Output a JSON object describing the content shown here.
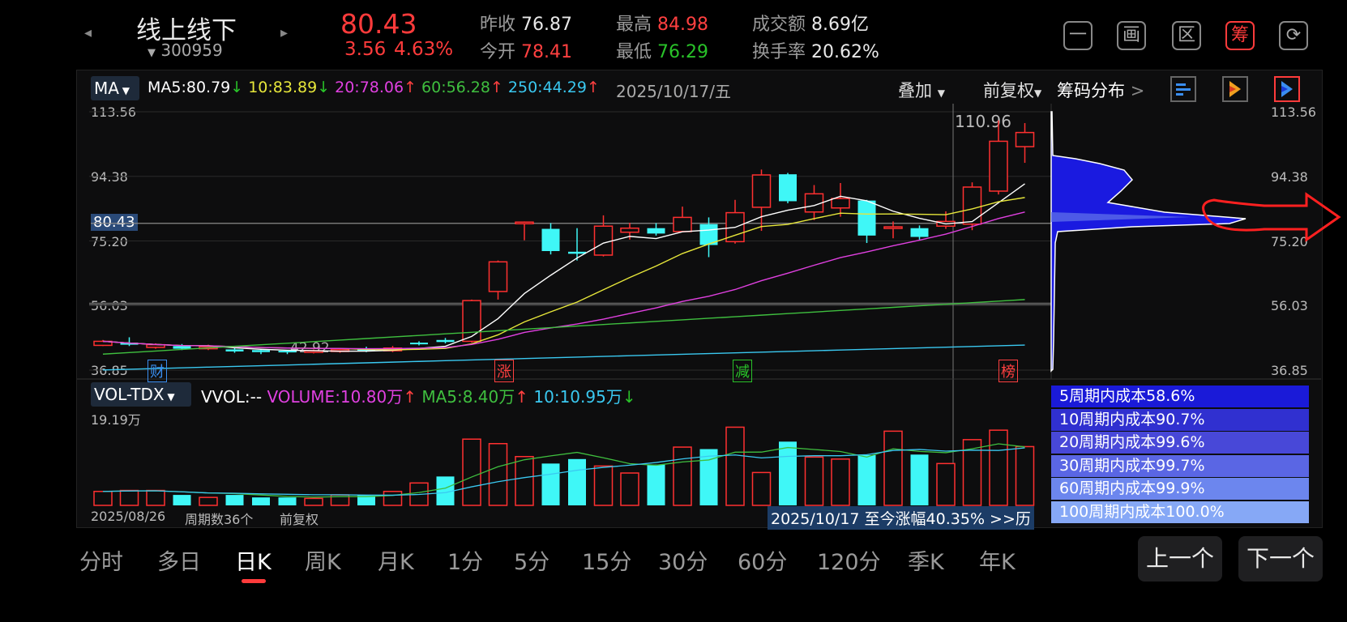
{
  "header": {
    "prev_arrow": "◂",
    "next_arrow": "▸",
    "stock_name": "线上线下",
    "stock_code": "300959",
    "price": "80.43",
    "change": "3.56",
    "change_pct": "4.63%",
    "stats": [
      {
        "label": "昨收",
        "value": "76.87",
        "color": "#e8e8e8"
      },
      {
        "label": "今开",
        "value": "78.41",
        "color": "#ff4040"
      },
      {
        "label": "最高",
        "value": "84.98",
        "color": "#ff4040"
      },
      {
        "label": "最低",
        "value": "76.29",
        "color": "#29c229"
      },
      {
        "label": "成交额",
        "value": "8.69亿",
        "color": "#e8e8e8"
      },
      {
        "label": "换手率",
        "value": "20.62%",
        "color": "#e8e8e8"
      }
    ],
    "buttons": [
      {
        "name": "minus",
        "glyph": "一"
      },
      {
        "name": "draw",
        "glyph": "画"
      },
      {
        "name": "region",
        "glyph": "区"
      },
      {
        "name": "chips",
        "glyph": "筹"
      },
      {
        "name": "rotate",
        "glyph": "⟳"
      }
    ]
  },
  "chart_toolbar": {
    "indicator": "MA",
    "ma_values": [
      {
        "text": "MA5:80.79",
        "arrow": "↓",
        "color": "#ffffff",
        "arrow_color": "#29c229"
      },
      {
        "text": "10:83.89",
        "arrow": "↓",
        "color": "#e6e63a",
        "arrow_color": "#29c229"
      },
      {
        "text": "20:78.06",
        "arrow": "↑",
        "color": "#e040e0",
        "arrow_color": "#ff4040"
      },
      {
        "text": "60:56.28",
        "arrow": "↑",
        "color": "#3fbf3f",
        "arrow_color": "#ff4040"
      },
      {
        "text": "250:44.29",
        "arrow": "↑",
        "color": "#3ac8f0",
        "arrow_color": "#ff4040"
      }
    ],
    "date": "2025/10/17/五",
    "overlay_label": "叠加",
    "adjust_label": "前复权",
    "chip_dist_label": "筹码分布",
    "chip_arrow": ">"
  },
  "price_axis": {
    "labels": [
      "113.56",
      "94.38",
      "75.20",
      "56.03",
      "36.85"
    ],
    "current_price_tag": "80.43",
    "peak_label": "110.96",
    "low_label": "42.92"
  },
  "markers": [
    {
      "text": "财",
      "color": "#3a8ef0"
    },
    {
      "text": "涨",
      "color": "#ff4040"
    },
    {
      "text": "减",
      "color": "#29c229"
    },
    {
      "text": "榜",
      "color": "#ff4040"
    }
  ],
  "volume_toolbar": {
    "indicator": "VOL-TDX",
    "vvol": "VVOL:--",
    "volume": "VOLUME:10.80万",
    "volume_arrow": "↑",
    "ma5": "MA5:8.40万",
    "ma5_arrow": "↑",
    "ma10": "10:10.95万",
    "ma10_arrow": "↓",
    "max_label": "19.19万"
  },
  "volume_footer": {
    "start_date": "2025/08/26",
    "period_count": "周期数36个",
    "adjust": "前复权",
    "range_info": "2025/10/17 至今涨幅40.35%",
    "range_more": ">>历"
  },
  "chip_costs": [
    {
      "text": "5周期内成本58.6%",
      "color": "#1a1ad8"
    },
    {
      "text": "10周期内成本90.7%",
      "color": "#3030d0"
    },
    {
      "text": "20周期内成本99.6%",
      "color": "#4848d8"
    },
    {
      "text": "30周期内成本99.7%",
      "color": "#5a66e4"
    },
    {
      "text": "60周期内成本99.9%",
      "color": "#6c86ee"
    },
    {
      "text": "100周期内成本100.0%",
      "color": "#86a8f6"
    }
  ],
  "period_tabs": [
    "分时",
    "多日",
    "日K",
    "周K",
    "月K",
    "1分",
    "5分",
    "15分",
    "30分",
    "60分",
    "120分",
    "季K",
    "年K"
  ],
  "active_tab": "日K",
  "nav": {
    "prev": "上一个",
    "next": "下一个"
  },
  "colors": {
    "up": "#ff3030",
    "down": "#3ff7f7",
    "accent": "#ff3b3b",
    "ma5": "#ffffff",
    "ma10": "#e6e63a",
    "ma20": "#e040e0",
    "ma60": "#3fbf3f",
    "ma250": "#3ac8f0"
  },
  "chart_data": {
    "type": "candlestick",
    "y_range": [
      36.85,
      113.56
    ],
    "candles": [
      {
        "o": 44.2,
        "c": 45.4,
        "h": 45.8,
        "l": 44.0,
        "up": true
      },
      {
        "o": 45.0,
        "c": 44.4,
        "h": 46.6,
        "l": 44.0,
        "up": false
      },
      {
        "o": 44.4,
        "c": 43.6,
        "h": 44.8,
        "l": 43.2,
        "up": true
      },
      {
        "o": 44.0,
        "c": 43.2,
        "h": 44.6,
        "l": 42.8,
        "up": false
      },
      {
        "o": 43.2,
        "c": 43.8,
        "h": 44.4,
        "l": 42.8,
        "up": true
      },
      {
        "o": 43.0,
        "c": 42.4,
        "h": 43.4,
        "l": 42.0,
        "up": false
      },
      {
        "o": 42.8,
        "c": 42.2,
        "h": 43.0,
        "l": 41.6,
        "up": false
      },
      {
        "o": 42.6,
        "c": 42.2,
        "h": 42.8,
        "l": 41.6,
        "up": false
      },
      {
        "o": 42.2,
        "c": 42.6,
        "h": 43.0,
        "l": 41.8,
        "up": true
      },
      {
        "o": 42.4,
        "c": 42.9,
        "h": 43.2,
        "l": 42.0,
        "up": true
      },
      {
        "o": 43.2,
        "c": 42.6,
        "h": 43.8,
        "l": 42.2,
        "up": false
      },
      {
        "o": 42.6,
        "c": 43.4,
        "h": 44.0,
        "l": 42.2,
        "up": true
      },
      {
        "o": 44.6,
        "c": 45.0,
        "h": 45.4,
        "l": 44.2,
        "up": false
      },
      {
        "o": 45.2,
        "c": 45.8,
        "h": 46.4,
        "l": 44.8,
        "up": false
      },
      {
        "o": 45.4,
        "c": 57.5,
        "h": 57.8,
        "l": 45.0,
        "up": true
      },
      {
        "o": 60.2,
        "c": 69.0,
        "h": 69.4,
        "l": 57.8,
        "up": true
      },
      {
        "o": 80.8,
        "c": 80.6,
        "h": 81.0,
        "l": 75.4,
        "up": true
      },
      {
        "o": 78.8,
        "c": 72.2,
        "h": 80.5,
        "l": 71.2,
        "up": false
      },
      {
        "o": 72.0,
        "c": 71.4,
        "h": 79.0,
        "l": 69.4,
        "up": false
      },
      {
        "o": 71.0,
        "c": 79.6,
        "h": 82.8,
        "l": 70.6,
        "up": true
      },
      {
        "o": 77.8,
        "c": 79.0,
        "h": 80.6,
        "l": 75.6,
        "up": true
      },
      {
        "o": 79.0,
        "c": 77.4,
        "h": 80.5,
        "l": 76.8,
        "up": false
      },
      {
        "o": 78.0,
        "c": 82.2,
        "h": 85.4,
        "l": 77.8,
        "up": true
      },
      {
        "o": 80.2,
        "c": 74.0,
        "h": 82.2,
        "l": 70.4,
        "up": false
      },
      {
        "o": 75.0,
        "c": 83.6,
        "h": 87.4,
        "l": 74.4,
        "up": true
      },
      {
        "o": 85.2,
        "c": 94.8,
        "h": 96.4,
        "l": 78.2,
        "up": true
      },
      {
        "o": 95.0,
        "c": 87.0,
        "h": 95.4,
        "l": 86.4,
        "up": false
      },
      {
        "o": 83.8,
        "c": 89.2,
        "h": 91.8,
        "l": 81.4,
        "up": true
      },
      {
        "o": 85.0,
        "c": 87.8,
        "h": 92.4,
        "l": 82.4,
        "up": true
      },
      {
        "o": 87.2,
        "c": 76.8,
        "h": 87.4,
        "l": 74.6,
        "up": false
      },
      {
        "o": 79.0,
        "c": 79.4,
        "h": 81.0,
        "l": 76.0,
        "up": true
      },
      {
        "o": 79.0,
        "c": 76.4,
        "h": 79.8,
        "l": 75.6,
        "up": false
      },
      {
        "o": 79.6,
        "c": 81.0,
        "h": 84.0,
        "l": 78.8,
        "up": true
      },
      {
        "o": 80.2,
        "c": 91.2,
        "h": 92.6,
        "l": 78.4,
        "up": true
      },
      {
        "o": 90.0,
        "c": 104.8,
        "h": 111.0,
        "l": 89.0,
        "up": true
      },
      {
        "o": 103.2,
        "c": 107.4,
        "h": 110.2,
        "l": 98.4,
        "up": true
      }
    ],
    "volume_max": 19.19,
    "volumes": [
      2.8,
      3.0,
      3.0,
      2.1,
      1.6,
      2.1,
      1.6,
      1.6,
      1.4,
      2.1,
      2.1,
      2.8,
      4.5,
      5.8,
      13.3,
      12.4,
      9.8,
      8.4,
      9.3,
      7.9,
      6.5,
      8.2,
      11.7,
      11.3,
      15.7,
      6.6,
      12.8,
      9.7,
      9.3,
      10.1,
      14.9,
      10.2,
      8.4,
      13.2,
      15.1,
      11.8
    ],
    "volume_up": [
      true,
      true,
      true,
      false,
      true,
      false,
      false,
      false,
      true,
      true,
      false,
      true,
      true,
      false,
      true,
      true,
      true,
      false,
      false,
      true,
      true,
      false,
      true,
      false,
      true,
      true,
      false,
      true,
      true,
      false,
      true,
      false,
      true,
      true,
      true,
      true
    ]
  }
}
